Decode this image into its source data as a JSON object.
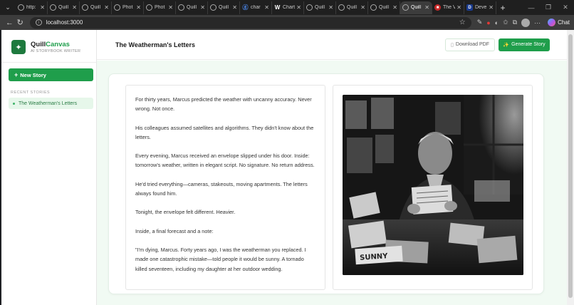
{
  "browser": {
    "tabs": [
      {
        "label": "http:",
        "icon": "globe-icon"
      },
      {
        "label": "Quill",
        "icon": "globe-icon"
      },
      {
        "label": "Quill",
        "icon": "globe-icon"
      },
      {
        "label": "Phot",
        "icon": "globe-icon"
      },
      {
        "label": "Phot",
        "icon": "globe-icon"
      },
      {
        "label": "Quill",
        "icon": "globe-icon"
      },
      {
        "label": "Quill",
        "icon": "globe-icon"
      },
      {
        "label": "char",
        "icon": "search-icon"
      },
      {
        "label": "Chart",
        "icon": "wikipedia-icon"
      },
      {
        "label": "Quill",
        "icon": "globe-icon"
      },
      {
        "label": "Quill",
        "icon": "globe-icon"
      },
      {
        "label": "Quill",
        "icon": "globe-icon"
      },
      {
        "label": "Quill",
        "icon": "globe-icon"
      },
      {
        "label": "The V",
        "icon": "news-icon"
      },
      {
        "label": "Deve",
        "icon": "dev-icon"
      }
    ],
    "active_tab_index": 12,
    "address": "localhost:3000",
    "copilot_label": "Chat"
  },
  "sidebar": {
    "brand_first": "Quill",
    "brand_second": "Canvas",
    "tagline": "AI STORYBOOK WRITER",
    "new_story_label": "New Story",
    "recent_title": "RECENT STORIES",
    "recent_items": [
      {
        "label": "The Weatherman's Letters"
      }
    ]
  },
  "header": {
    "title": "The Weatherman's Letters",
    "download_label": "Download PDF",
    "generate_label": "Generate Story"
  },
  "story": {
    "paragraphs": [
      "For thirty years, Marcus predicted the weather with uncanny accuracy. Never wrong. Not once.",
      "His colleagues assumed satellites and algorithms. They didn't know about the letters.",
      "Every evening, Marcus received an envelope slipped under his door. Inside: tomorrow's weather, written in elegant script. No signature. No return address.",
      "He'd tried everything—cameras, stakeouts, moving apartments. The letters always found him.",
      "Tonight, the envelope felt different. Heavier.",
      "Inside, a final forecast and a note:",
      "\"I'm dying, Marcus. Forty years ago, I was the weatherman you replaced. I made one catastrophic mistake—told people it would be sunny. A tornado killed seventeen, including my daughter at her outdoor wedding."
    ]
  },
  "illustration": {
    "newspaper_label": "SUNNY"
  }
}
